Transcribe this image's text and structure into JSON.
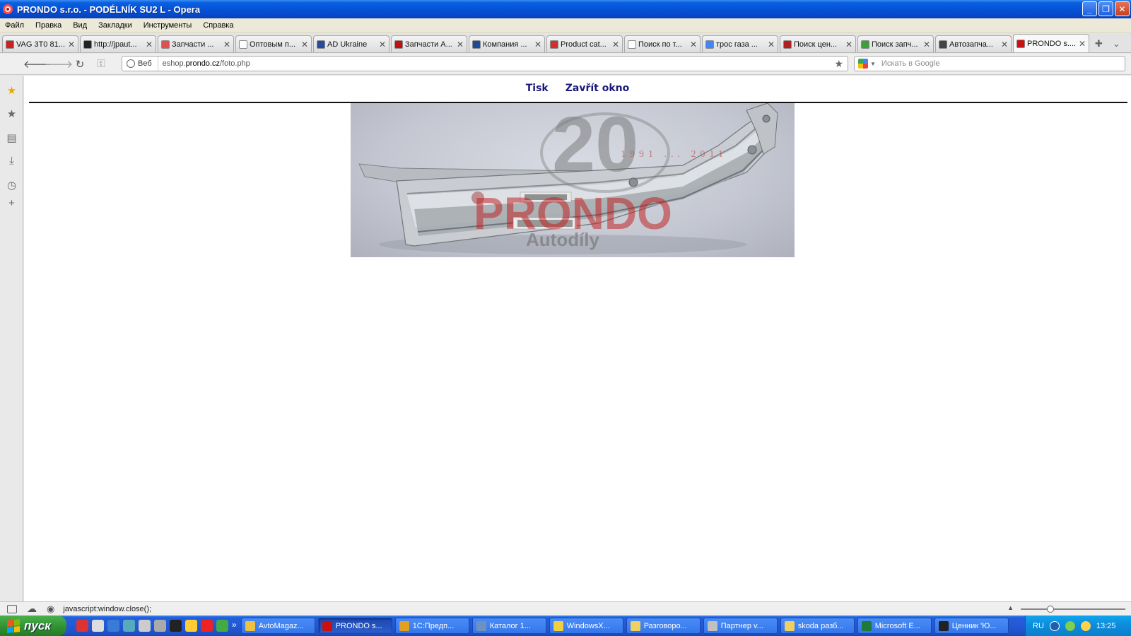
{
  "window": {
    "title": "PRONDO s.r.o. - PODÉLNÍK SU2 L - Opera",
    "buttons": [
      "minimize",
      "restore",
      "close"
    ]
  },
  "menu": [
    "Файл",
    "Правка",
    "Вид",
    "Закладки",
    "Инструменты",
    "Справка"
  ],
  "tabs": [
    {
      "label": "VAG 3T0 81...",
      "icon_color": "#cc2222"
    },
    {
      "label": "http://jpaut...",
      "icon_color": "#222222"
    },
    {
      "label": "Запчасти ...",
      "icon_color": "#e05050"
    },
    {
      "label": "Оптовым п...",
      "icon_color": "#ffffff"
    },
    {
      "label": "AD Ukraine",
      "icon_color": "#2a4aa0"
    },
    {
      "label": "Запчасти А...",
      "icon_color": "#c01010"
    },
    {
      "label": "Компания ...",
      "icon_color": "#1f4a9a"
    },
    {
      "label": "Product cat...",
      "icon_color": "#d03030"
    },
    {
      "label": "Поиск по т...",
      "icon_color": "#ffffff"
    },
    {
      "label": "трос газа ...",
      "icon_color": "#4285f4"
    },
    {
      "label": "Поиск цен...",
      "icon_color": "#b02020"
    },
    {
      "label": "Поиск запч...",
      "icon_color": "#3aa03a"
    },
    {
      "label": "Автозапча...",
      "icon_color": "#444444"
    },
    {
      "label": "PRONDO s....",
      "icon_color": "#cc1010",
      "active": true
    }
  ],
  "address": {
    "web_label": "Веб",
    "url_prefix": "eshop.",
    "url_host": "prondo.cz",
    "url_path": "/foto.php",
    "search_placeholder": "Искать в Google"
  },
  "page": {
    "link_print": "Tisk",
    "link_close": "Zavřít okno",
    "photo_alt": "PODÉLNÍK SU2 L",
    "watermark_years": "1991 ... 2011",
    "watermark_brand": "PRONDO",
    "watermark_sub": "Autodíly",
    "watermark_20": "20"
  },
  "status": {
    "text": "javascript:window.close();"
  },
  "taskbar": {
    "start_label": "пуск",
    "tasks": [
      {
        "label": "AvtoMagaz...",
        "icon_color": "#f0c040"
      },
      {
        "label": "PRONDO s...",
        "icon_color": "#cc1010",
        "active": true
      },
      {
        "label": "1С:Предп...",
        "icon_color": "#e2a020"
      },
      {
        "label": "Каталог 1...",
        "icon_color": "#7090c0"
      },
      {
        "label": "WindowsX...",
        "icon_color": "#f0d040"
      },
      {
        "label": "Разговоро...",
        "icon_color": "#f0d060"
      },
      {
        "label": "Партнер v...",
        "icon_color": "#c0c0c0"
      },
      {
        "label": "skoda разб...",
        "icon_color": "#f0d060"
      },
      {
        "label": "Microsoft E...",
        "icon_color": "#1f7a3a"
      },
      {
        "label": "Ценник 'Ю...",
        "icon_color": "#222222"
      }
    ],
    "lang": "RU",
    "clock": "13:25"
  }
}
